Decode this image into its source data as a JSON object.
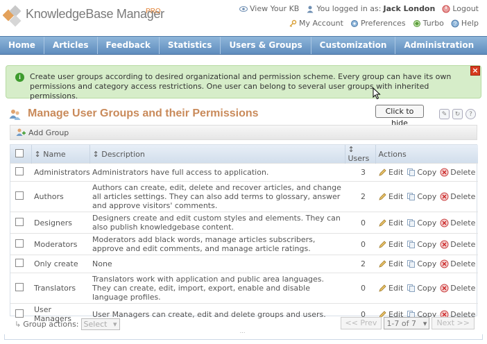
{
  "app": {
    "name": "KnowledgeBase Manager",
    "badge": "PRO"
  },
  "top": {
    "view_kb": "View Your KB",
    "logged_in_as": "You logged in as:",
    "user": "Jack London",
    "logout": "Logout",
    "my_account": "My Account",
    "preferences": "Preferences",
    "turbo": "Turbo",
    "help": "Help"
  },
  "nav": [
    "Home",
    "Articles",
    "Feedback",
    "Statistics",
    "Users & Groups",
    "Customization",
    "Administration"
  ],
  "info": {
    "text": "Create user groups according to desired organizational and permission scheme. Every group can have its own permissions and category access restrictions. One user can belong to several user groups with inherited permissions.",
    "tooltip": "Click to hide"
  },
  "page": {
    "title": "Manage User Groups and their Permissions",
    "add_group": "Add Group"
  },
  "table": {
    "headers": {
      "name": "Name",
      "description": "Description",
      "users": "Users",
      "actions": "Actions"
    },
    "action_labels": {
      "edit": "Edit",
      "copy": "Copy",
      "delete": "Delete"
    },
    "rows": [
      {
        "name": "Administrators",
        "description": "Administrators have full access to application.",
        "users": "3"
      },
      {
        "name": "Authors",
        "description": "Authors can create, edit, delete and recover articles, and change all articles settings. They can also add terms to glossary, answer and approve visitors' comments.",
        "users": "2"
      },
      {
        "name": "Designers",
        "description": "Designers create and edit custom styles and elements. They can also publish knowledgebase content.",
        "users": "0"
      },
      {
        "name": "Moderators",
        "description": "Moderators add black words, manage articles subscribers, approve and edit comments, and manage article ratings.",
        "users": "0"
      },
      {
        "name": "Only create",
        "description": "None",
        "users": "2"
      },
      {
        "name": "Translators",
        "description": "Translators work with application and public area languages. They can create, edit, import, export, enable and disable language profiles.",
        "users": "0"
      },
      {
        "name": "User Managers",
        "description": "User Managers can create, edit and delete groups and users.",
        "users": "0"
      }
    ]
  },
  "footer": {
    "group_actions": "Group actions:",
    "select_placeholder": "Select",
    "prev": "<< Prev",
    "page_info": "1-7 of 7",
    "next": "Next >>"
  },
  "colors": {
    "nav_bg": "#6f9bc8",
    "info_bg": "#d6edc9",
    "title": "#c98a5a",
    "close": "#d63a1e"
  }
}
